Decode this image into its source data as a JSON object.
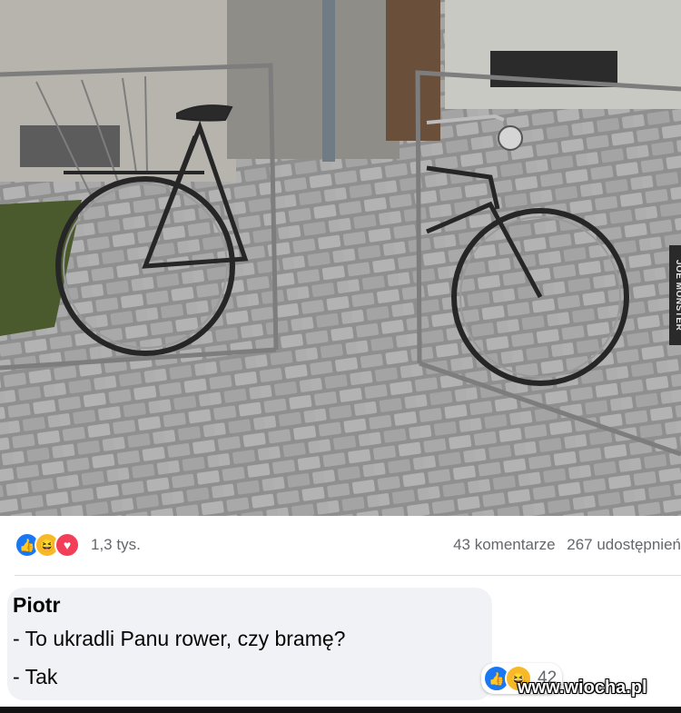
{
  "photo": {
    "watermark_side": "JOE MONSTER"
  },
  "post_stats": {
    "reaction_icons": [
      "like-icon",
      "haha-icon",
      "love-icon"
    ],
    "reaction_count": "1,3 tys.",
    "comments": "43 komentarze",
    "shares": "267 udostępnień"
  },
  "comment": {
    "author": "Piotr",
    "line1": "- To ukradli Panu rower, czy bramę?",
    "line2": "- Tak",
    "reaction_icons": [
      "like-icon",
      "haha-icon"
    ],
    "reaction_count": "42"
  },
  "watermark": "www.wiocha.pl",
  "colors": {
    "like": "#1877f2",
    "haha": "#f7b928",
    "love": "#f33e58",
    "bubble": "#f0f2f5"
  }
}
